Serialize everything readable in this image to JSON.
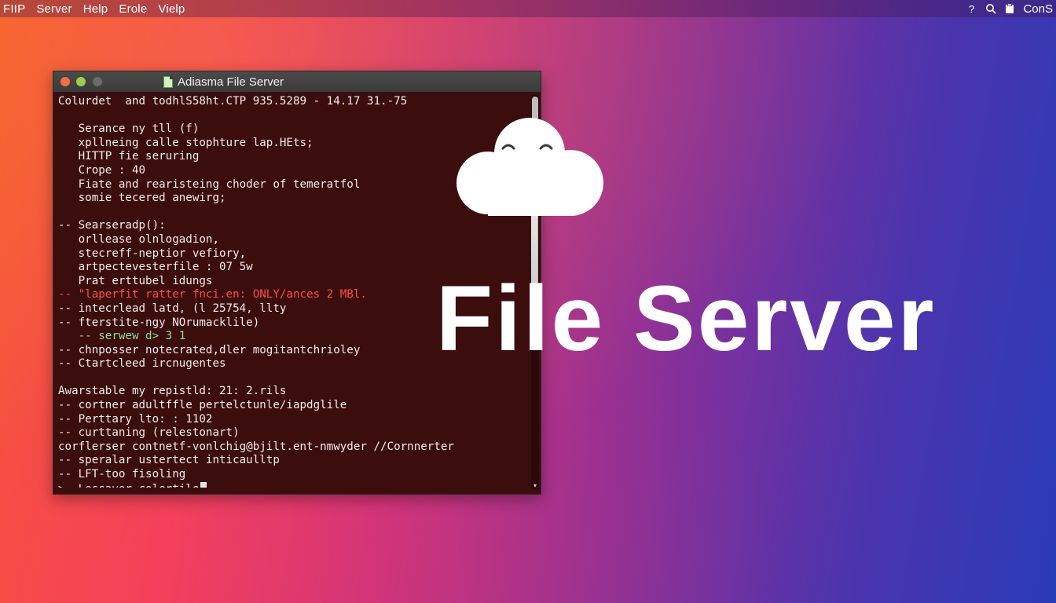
{
  "menubar": {
    "items": [
      "FIIP",
      "Server",
      "Help",
      "Erole",
      "Vielp"
    ],
    "right_label": "ConS",
    "icons": [
      "help-icon",
      "search-icon",
      "clipboard-icon"
    ]
  },
  "window": {
    "title": "Adiasma File Server",
    "lines": [
      {
        "text": "Colurdet  and todhlS58ht.CTP 935.5289 - 14.17 31.-75",
        "color": "default"
      },
      {
        "text": "",
        "color": "default"
      },
      {
        "text": "   Serance ny tll (f)",
        "color": "default"
      },
      {
        "text": "   xpllneing calle stophture lap.HEts;",
        "color": "default"
      },
      {
        "text": "   HITTP fie seruring",
        "color": "default"
      },
      {
        "text": "   Crope : 40",
        "color": "default"
      },
      {
        "text": "   Fiate and rearisteing choder of temeratfol",
        "color": "default"
      },
      {
        "text": "   somie tecered anewirg;",
        "color": "default"
      },
      {
        "text": "",
        "color": "default"
      },
      {
        "text": "-- Searseradp():",
        "color": "default"
      },
      {
        "text": "   orllease olnlogadion,",
        "color": "default"
      },
      {
        "text": "   stecreff-neptior vefiory,",
        "color": "default"
      },
      {
        "text": "   artpectevesterfile : 07 5w",
        "color": "default"
      },
      {
        "text": "   Prat erttubel idungs",
        "color": "default"
      },
      {
        "text": "-- \"laperfit ratter fnci.en: ONLY/ances 2 MBl.",
        "color": "red"
      },
      {
        "text": "-- intecrlead latd, (l 25754, llty",
        "color": "default"
      },
      {
        "text": "-- fterstite-ngy NOrumacklile)",
        "color": "default"
      },
      {
        "text": "   -- serwew d> 3 1",
        "color": "green"
      },
      {
        "text": "-- chnposser notecrated,dler mogitantchrioley",
        "color": "default"
      },
      {
        "text": "-- Ctartcleed ircnugentes",
        "color": "default"
      },
      {
        "text": "",
        "color": "default"
      },
      {
        "text": "Awarstable my repistld: 21: 2.rils",
        "color": "default"
      },
      {
        "text": "-- cortner adultffle pertelctunle/iapdglile",
        "color": "default"
      },
      {
        "text": "-- Perttary lto: : 1102",
        "color": "default"
      },
      {
        "text": "-- curttaning (relestonart)",
        "color": "default"
      },
      {
        "text": "corflerser contnetf-vonlchig@bjilt.ent-nmwyder //Cornnerter",
        "color": "default"
      },
      {
        "text": "-- speralar ustertect inticaulltp",
        "color": "default"
      },
      {
        "text": "-- LFT-too fisoling",
        "color": "default"
      },
      {
        "text": ">- Lessaver colertile",
        "color": "default",
        "cursor": true
      }
    ]
  },
  "headline": "File Server",
  "colors": {
    "terminal_bg": "#3c0d0d",
    "terminal_text": "#f3ecec",
    "error_text": "#ff4b4b",
    "success_text": "#8fe08a",
    "gradient_start": "#f55a2c",
    "gradient_end": "#2a3bb8"
  }
}
